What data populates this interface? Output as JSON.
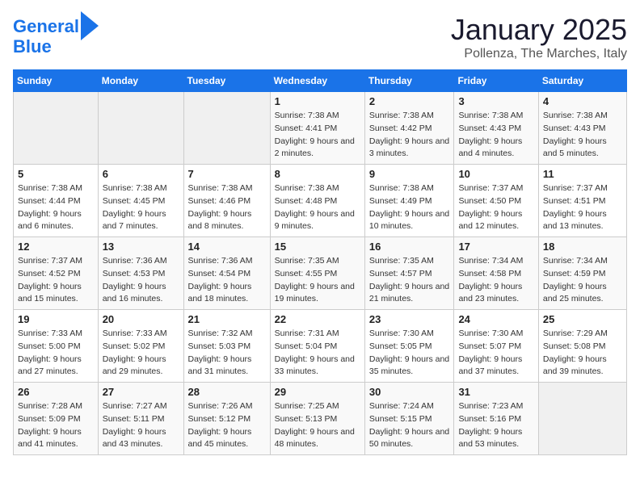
{
  "header": {
    "logo_line1": "General",
    "logo_line2": "Blue",
    "title": "January 2025",
    "subtitle": "Pollenza, The Marches, Italy"
  },
  "days_of_week": [
    "Sunday",
    "Monday",
    "Tuesday",
    "Wednesday",
    "Thursday",
    "Friday",
    "Saturday"
  ],
  "weeks": [
    [
      {
        "day": "",
        "info": ""
      },
      {
        "day": "",
        "info": ""
      },
      {
        "day": "",
        "info": ""
      },
      {
        "day": "1",
        "info": "Sunrise: 7:38 AM\nSunset: 4:41 PM\nDaylight: 9 hours and 2 minutes."
      },
      {
        "day": "2",
        "info": "Sunrise: 7:38 AM\nSunset: 4:42 PM\nDaylight: 9 hours and 3 minutes."
      },
      {
        "day": "3",
        "info": "Sunrise: 7:38 AM\nSunset: 4:43 PM\nDaylight: 9 hours and 4 minutes."
      },
      {
        "day": "4",
        "info": "Sunrise: 7:38 AM\nSunset: 4:43 PM\nDaylight: 9 hours and 5 minutes."
      }
    ],
    [
      {
        "day": "5",
        "info": "Sunrise: 7:38 AM\nSunset: 4:44 PM\nDaylight: 9 hours and 6 minutes."
      },
      {
        "day": "6",
        "info": "Sunrise: 7:38 AM\nSunset: 4:45 PM\nDaylight: 9 hours and 7 minutes."
      },
      {
        "day": "7",
        "info": "Sunrise: 7:38 AM\nSunset: 4:46 PM\nDaylight: 9 hours and 8 minutes."
      },
      {
        "day": "8",
        "info": "Sunrise: 7:38 AM\nSunset: 4:48 PM\nDaylight: 9 hours and 9 minutes."
      },
      {
        "day": "9",
        "info": "Sunrise: 7:38 AM\nSunset: 4:49 PM\nDaylight: 9 hours and 10 minutes."
      },
      {
        "day": "10",
        "info": "Sunrise: 7:37 AM\nSunset: 4:50 PM\nDaylight: 9 hours and 12 minutes."
      },
      {
        "day": "11",
        "info": "Sunrise: 7:37 AM\nSunset: 4:51 PM\nDaylight: 9 hours and 13 minutes."
      }
    ],
    [
      {
        "day": "12",
        "info": "Sunrise: 7:37 AM\nSunset: 4:52 PM\nDaylight: 9 hours and 15 minutes."
      },
      {
        "day": "13",
        "info": "Sunrise: 7:36 AM\nSunset: 4:53 PM\nDaylight: 9 hours and 16 minutes."
      },
      {
        "day": "14",
        "info": "Sunrise: 7:36 AM\nSunset: 4:54 PM\nDaylight: 9 hours and 18 minutes."
      },
      {
        "day": "15",
        "info": "Sunrise: 7:35 AM\nSunset: 4:55 PM\nDaylight: 9 hours and 19 minutes."
      },
      {
        "day": "16",
        "info": "Sunrise: 7:35 AM\nSunset: 4:57 PM\nDaylight: 9 hours and 21 minutes."
      },
      {
        "day": "17",
        "info": "Sunrise: 7:34 AM\nSunset: 4:58 PM\nDaylight: 9 hours and 23 minutes."
      },
      {
        "day": "18",
        "info": "Sunrise: 7:34 AM\nSunset: 4:59 PM\nDaylight: 9 hours and 25 minutes."
      }
    ],
    [
      {
        "day": "19",
        "info": "Sunrise: 7:33 AM\nSunset: 5:00 PM\nDaylight: 9 hours and 27 minutes."
      },
      {
        "day": "20",
        "info": "Sunrise: 7:33 AM\nSunset: 5:02 PM\nDaylight: 9 hours and 29 minutes."
      },
      {
        "day": "21",
        "info": "Sunrise: 7:32 AM\nSunset: 5:03 PM\nDaylight: 9 hours and 31 minutes."
      },
      {
        "day": "22",
        "info": "Sunrise: 7:31 AM\nSunset: 5:04 PM\nDaylight: 9 hours and 33 minutes."
      },
      {
        "day": "23",
        "info": "Sunrise: 7:30 AM\nSunset: 5:05 PM\nDaylight: 9 hours and 35 minutes."
      },
      {
        "day": "24",
        "info": "Sunrise: 7:30 AM\nSunset: 5:07 PM\nDaylight: 9 hours and 37 minutes."
      },
      {
        "day": "25",
        "info": "Sunrise: 7:29 AM\nSunset: 5:08 PM\nDaylight: 9 hours and 39 minutes."
      }
    ],
    [
      {
        "day": "26",
        "info": "Sunrise: 7:28 AM\nSunset: 5:09 PM\nDaylight: 9 hours and 41 minutes."
      },
      {
        "day": "27",
        "info": "Sunrise: 7:27 AM\nSunset: 5:11 PM\nDaylight: 9 hours and 43 minutes."
      },
      {
        "day": "28",
        "info": "Sunrise: 7:26 AM\nSunset: 5:12 PM\nDaylight: 9 hours and 45 minutes."
      },
      {
        "day": "29",
        "info": "Sunrise: 7:25 AM\nSunset: 5:13 PM\nDaylight: 9 hours and 48 minutes."
      },
      {
        "day": "30",
        "info": "Sunrise: 7:24 AM\nSunset: 5:15 PM\nDaylight: 9 hours and 50 minutes."
      },
      {
        "day": "31",
        "info": "Sunrise: 7:23 AM\nSunset: 5:16 PM\nDaylight: 9 hours and 53 minutes."
      },
      {
        "day": "",
        "info": ""
      }
    ]
  ]
}
